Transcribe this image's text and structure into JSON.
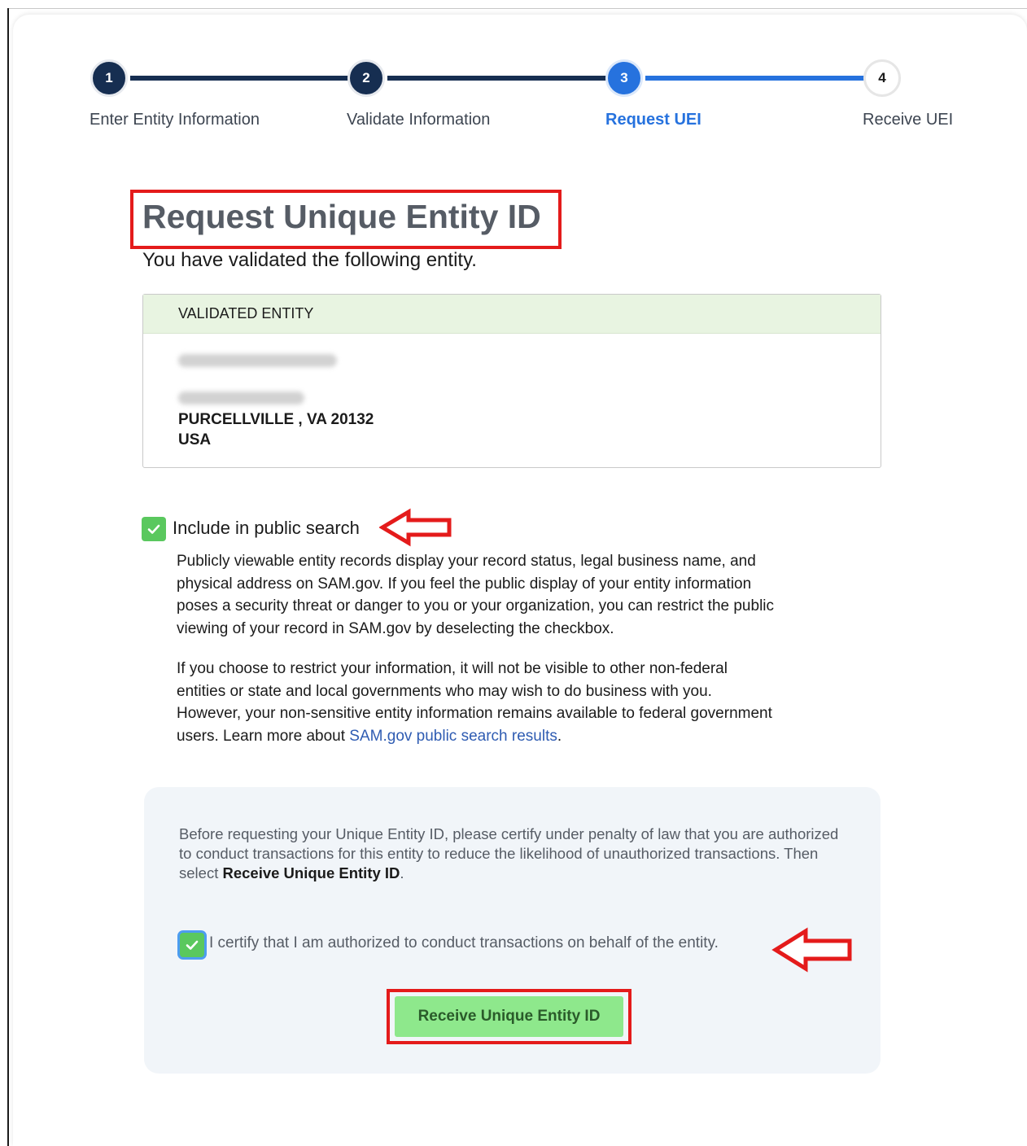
{
  "stepper": {
    "steps": [
      {
        "number": "1",
        "label": "Enter Entity Information",
        "state": "done"
      },
      {
        "number": "2",
        "label": "Validate Information",
        "state": "done"
      },
      {
        "number": "3",
        "label": "Request UEI",
        "state": "current"
      },
      {
        "number": "4",
        "label": "Receive UEI",
        "state": "todo"
      }
    ]
  },
  "page": {
    "title": "Request Unique Entity ID",
    "intro": "You have validated the following entity."
  },
  "entity": {
    "header": "VALIDATED ENTITY",
    "city_line": "PURCELLVILLE , VA 20132",
    "country": "USA"
  },
  "public_search": {
    "label": "Include in public search",
    "checked": true,
    "para1": "Publicly viewable entity records display your record status, legal business name, and physical address on SAM.gov. If you feel the public display of your entity information poses a security threat or danger to you or your organization, you can restrict the public viewing of your record in SAM.gov by deselecting the checkbox.",
    "para2_prefix": "If you choose to restrict your information, it will not be visible to other non-federal entities or state and local governments who may wish to do business with you. However, your non-sensitive entity information remains available to federal government users. Learn more about ",
    "para2_link": "SAM.gov public search results",
    "para2_suffix": "."
  },
  "certify": {
    "text_prefix": "Before requesting your Unique Entity ID, please certify under penalty of law that you are authorized to conduct transactions for this entity to reduce the likelihood of unauthorized transactions. Then select ",
    "text_bold": "Receive Unique Entity ID",
    "text_suffix": ".",
    "checkbox_label": "I certify that I am authorized to conduct transactions on behalf of the entity.",
    "checked": true
  },
  "button": {
    "label": "Receive Unique Entity ID"
  },
  "colors": {
    "step_done": "#162e51",
    "step_current": "#2672de",
    "highlight_red": "#e41b1b",
    "checkbox_green": "#5ac85e",
    "button_green": "#8ee88c"
  }
}
